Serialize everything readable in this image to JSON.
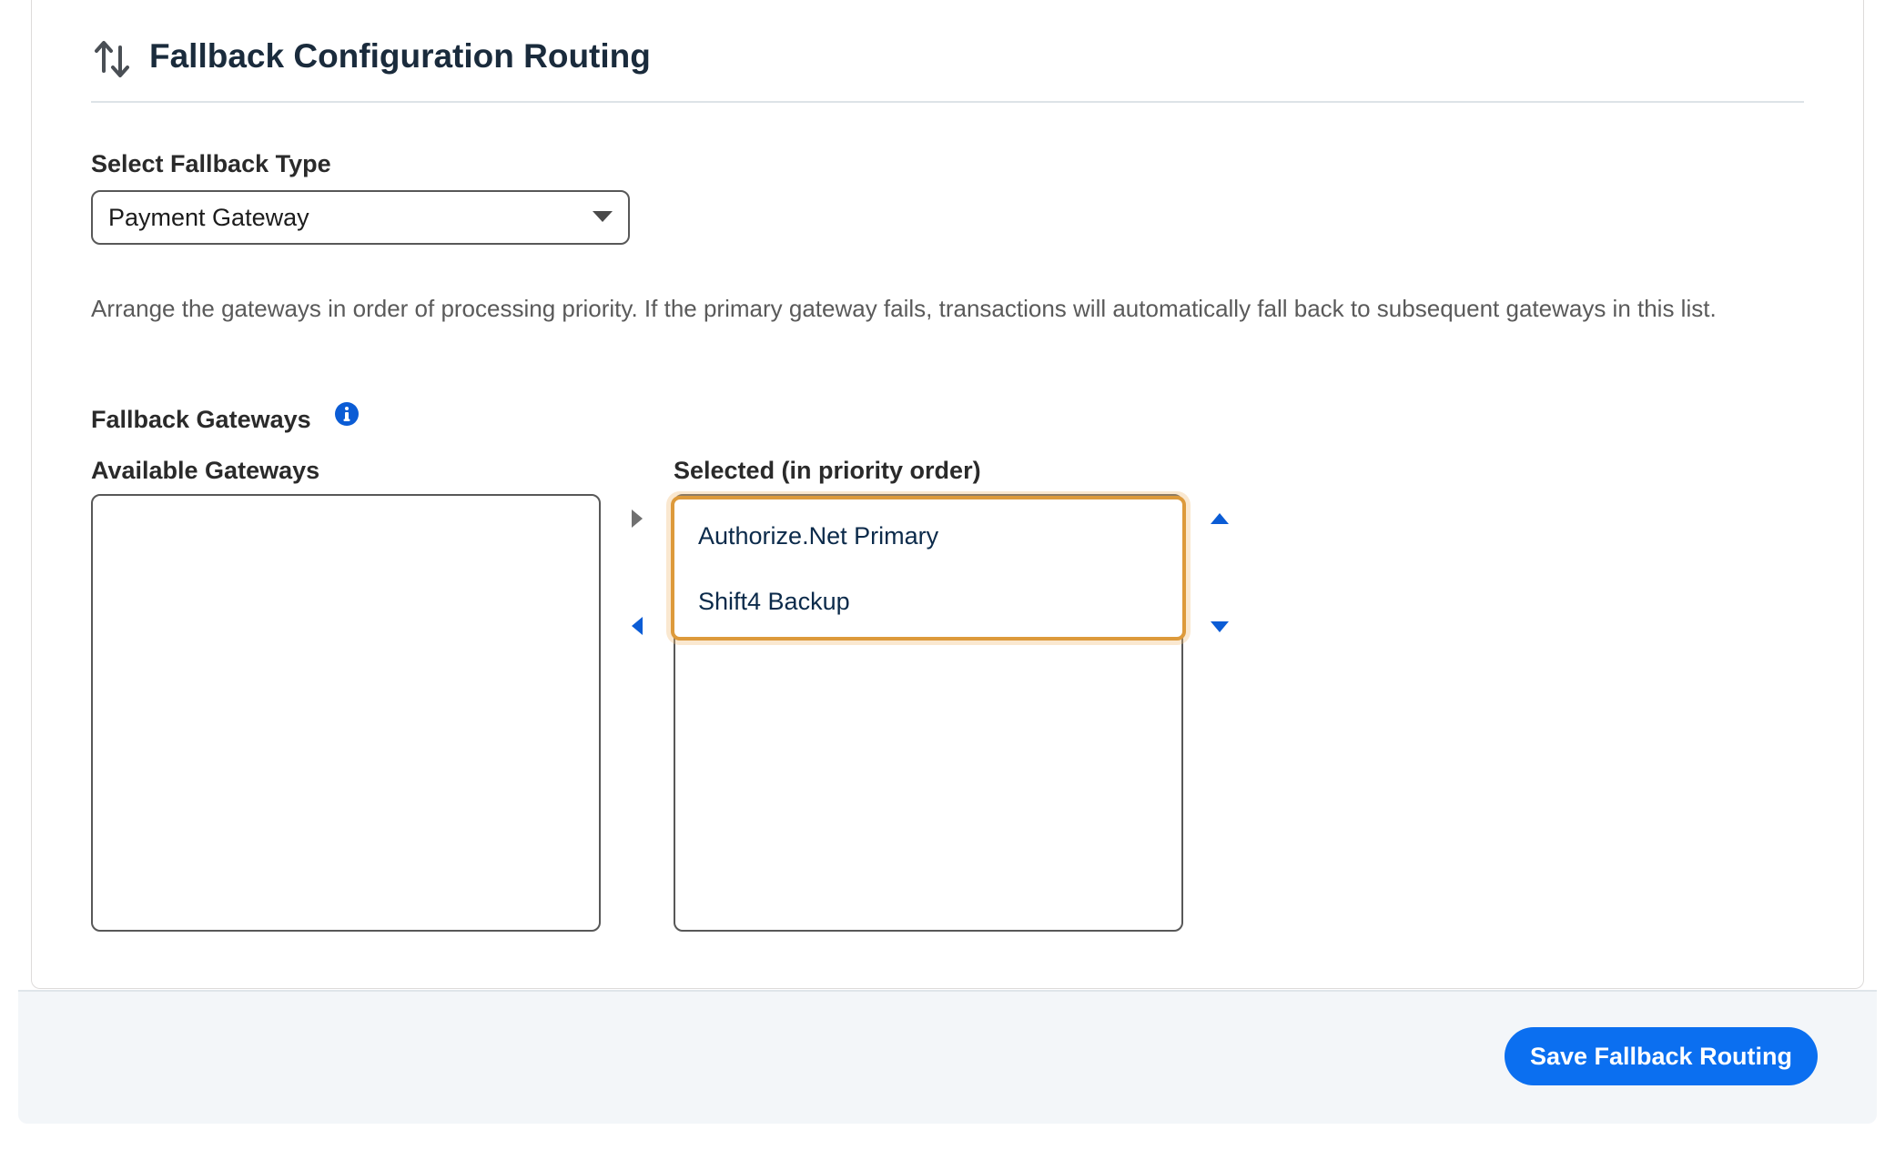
{
  "header": {
    "title": "Fallback Configuration Routing",
    "icon": "sort-arrows-icon"
  },
  "fallback_type": {
    "label": "Select Fallback Type",
    "value": "Payment Gateway"
  },
  "help_text": "Arrange the gateways in order of processing priority. If the primary gateway fails, transactions will automatically fall back to subsequent gateways in this list.",
  "gateways": {
    "label": "Fallback Gateways",
    "info_icon": "info-icon",
    "available_label": "Available Gateways",
    "available_items": [],
    "selected_label": "Selected (in priority order)",
    "selected_items": [
      "Authorize.Net Primary",
      "Shift4 Backup"
    ]
  },
  "footer": {
    "save_label": "Save Fallback Routing"
  },
  "colors": {
    "accent": "#0b6ff0",
    "focus": "#dd9a3b",
    "heading": "#1a2b3c"
  }
}
